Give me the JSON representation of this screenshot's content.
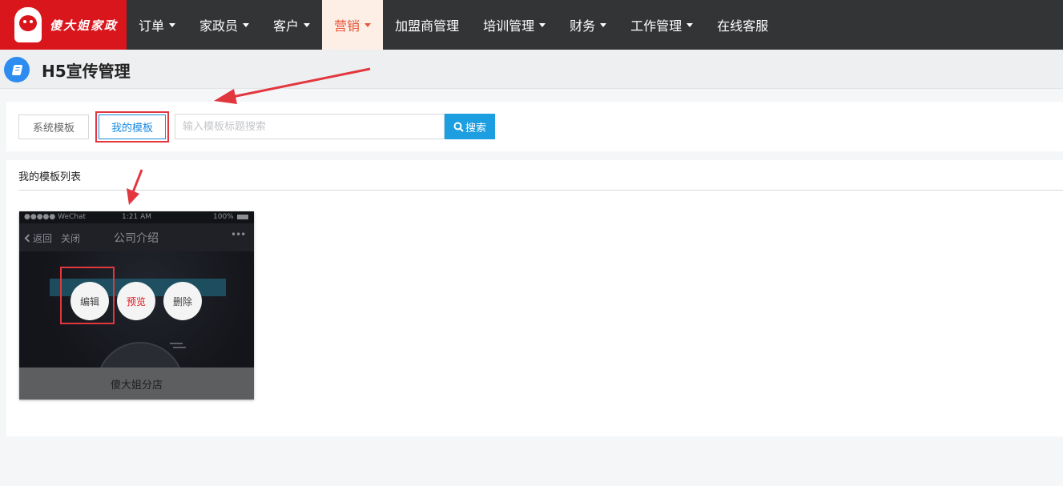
{
  "brand": {
    "name": "傻大姐家政"
  },
  "nav": {
    "items": [
      {
        "label": "订单",
        "has_dropdown": true,
        "active": false
      },
      {
        "label": "家政员",
        "has_dropdown": true,
        "active": false
      },
      {
        "label": "客户",
        "has_dropdown": true,
        "active": false
      },
      {
        "label": "营销",
        "has_dropdown": true,
        "active": true
      },
      {
        "label": "加盟商管理",
        "has_dropdown": false,
        "active": false
      },
      {
        "label": "培训管理",
        "has_dropdown": true,
        "active": false
      },
      {
        "label": "财务",
        "has_dropdown": true,
        "active": false
      },
      {
        "label": "工作管理",
        "has_dropdown": true,
        "active": false
      },
      {
        "label": "在线客服",
        "has_dropdown": false,
        "active": false
      }
    ]
  },
  "page": {
    "title": "H5宣传管理",
    "icon": "book-icon"
  },
  "toolbar": {
    "tab_system": "系统模板",
    "tab_mine": "我的模板",
    "active_tab": "我的模板",
    "search_placeholder": "输入模板标题搜索",
    "search_value": "",
    "search_button": "搜索"
  },
  "list": {
    "title": "我的模板列表",
    "templates": [
      {
        "name": "傻大姐分店",
        "preview": {
          "carrier": "●●●●● WeChat",
          "time": "1:21 AM",
          "battery": "100%",
          "back": "返回",
          "close": "关闭",
          "title": "公司介绍",
          "more": "•••"
        },
        "actions": {
          "edit": "编辑",
          "preview": "预览",
          "delete": "删除"
        }
      }
    ]
  },
  "colors": {
    "nav_bg": "#333436",
    "brand_red": "#d9161c",
    "active_nav_bg": "#fdefe6",
    "active_nav_text": "#e8563b",
    "primary_blue": "#1c9ee0",
    "annotation_red": "#e2373f"
  }
}
